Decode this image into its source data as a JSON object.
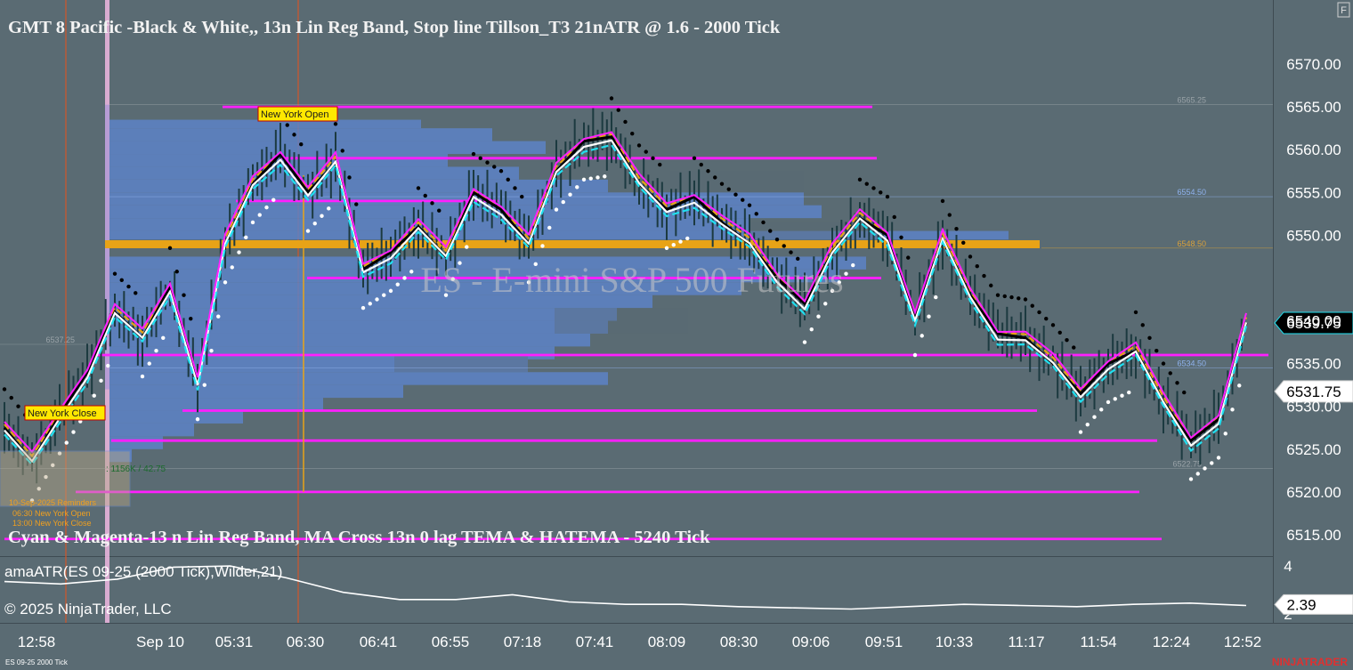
{
  "window": {
    "title": "GMT 8 Pacific -Black & White,, 13n Lin Reg Band, Stop line Tillson_T3 21nATR @ 1.6 - 2000 Tick",
    "f_button": "F",
    "watermark": "ES - E-mini S&P 500 Futures",
    "copyright": "© 2025 NinjaTrader, LLC",
    "brand": "NINJATRADER",
    "footer_label": "ES 09-25 2000 Tick",
    "bg_color": "#5a6b73",
    "accent_magenta": "#ff1fff",
    "accent_orange": "#e8a317"
  },
  "labels": {
    "band_title": "Cyan & Magenta-13 n Lin Reg Band, MA Cross 13n 0 lag TEMA & HATEMA   - 5240 Tick",
    "ny_open": "New York Open",
    "ny_close": "New York Close",
    "reminder_1": "10-Sep-2025 Reminders",
    "reminder_2": "06:30 New York Open",
    "reminder_3": "13:00 New York Close",
    "volume_readout": ": 1156K / 42.75"
  },
  "chart_data": [
    {
      "type": "line",
      "title": "GMT 8 Pacific -Black & White,, 13n Lin Reg Band, Stop line Tillson_T3 21nATR @ 1.6 - 2000 Tick",
      "y_axis_ticks": [
        6570.0,
        6565.0,
        6560.0,
        6555.0,
        6550.0,
        6545.0,
        6540.0,
        6535.0,
        6530.0,
        6525.0,
        6520.0,
        6515.0
      ],
      "y_axis_labels": [
        "6570.00",
        "6565.00",
        "6560.00",
        "6555.00",
        "6550.00",
        "6540.00",
        "6535.00",
        "6530.00",
        "6525.00",
        "6520.00",
        "6515.00"
      ],
      "ylim": [
        6512.5,
        6572.5
      ],
      "x_tick_labels": [
        "12:58",
        "Sep 10",
        "05:31",
        "06:30",
        "06:41",
        "06:55",
        "07:18",
        "07:41",
        "08:09",
        "08:30",
        "09:06",
        "09:51",
        "10:33",
        "11:17",
        "11:54",
        "12:24",
        "12:52"
      ],
      "price_markers": [
        {
          "label": "6539.75",
          "value": 6539.75,
          "style": "dark"
        },
        {
          "label": "6531.75",
          "value": 6531.75,
          "style": "light"
        }
      ],
      "profile_levels": [
        {
          "label": "6565.25",
          "value": 6565.25
        },
        {
          "label": "6554.50",
          "value": 6554.5
        },
        {
          "label": "6548.50",
          "value": 6548.5
        },
        {
          "label": "6534.50",
          "value": 6534.5
        },
        {
          "label": "6537.25",
          "value": 6537.25
        },
        {
          "label": "6522.75",
          "value": 6522.75
        }
      ],
      "horizontal_levels": [
        6565.0,
        6559.0,
        6554.0,
        6545.0,
        6536.0,
        6529.5,
        6526.0,
        6520.0,
        6514.5
      ],
      "poc_level": 6549.0,
      "price_path": [
        6527.5,
        6523.5,
        6529.0,
        6534.0,
        6541.0,
        6538.0,
        6544.0,
        6533.0,
        6549.0,
        6556.0,
        6559.5,
        6555.0,
        6558.5,
        6546.0,
        6548.0,
        6551.0,
        6547.5,
        6555.0,
        6553.0,
        6549.0,
        6557.5,
        6561.0,
        6561.5,
        6556.0,
        6553.0,
        6554.5,
        6551.5,
        6549.0,
        6545.0,
        6542.0,
        6548.0,
        6552.0,
        6550.0,
        6540.5,
        6549.5,
        6543.0,
        6538.5,
        6538.0,
        6535.0,
        6531.5,
        6535.0,
        6536.5,
        6530.5,
        6526.0,
        6528.5,
        6539.75
      ]
    },
    {
      "type": "line",
      "title": "amaATR(ES 09-25 (2000 Tick),Wilder,21)",
      "y_axis_labels": [
        "4",
        "2"
      ],
      "ylim": [
        1.7,
        4.3
      ],
      "value_marker": "2.39",
      "atr_path": [
        3.35,
        3.25,
        3.45,
        3.95,
        4.0,
        3.5,
        2.9,
        2.6,
        2.6,
        2.8,
        2.5,
        2.4,
        2.4,
        2.3,
        2.25,
        2.2,
        2.3,
        2.4,
        2.35,
        2.3,
        2.4,
        2.45,
        2.35
      ]
    }
  ]
}
